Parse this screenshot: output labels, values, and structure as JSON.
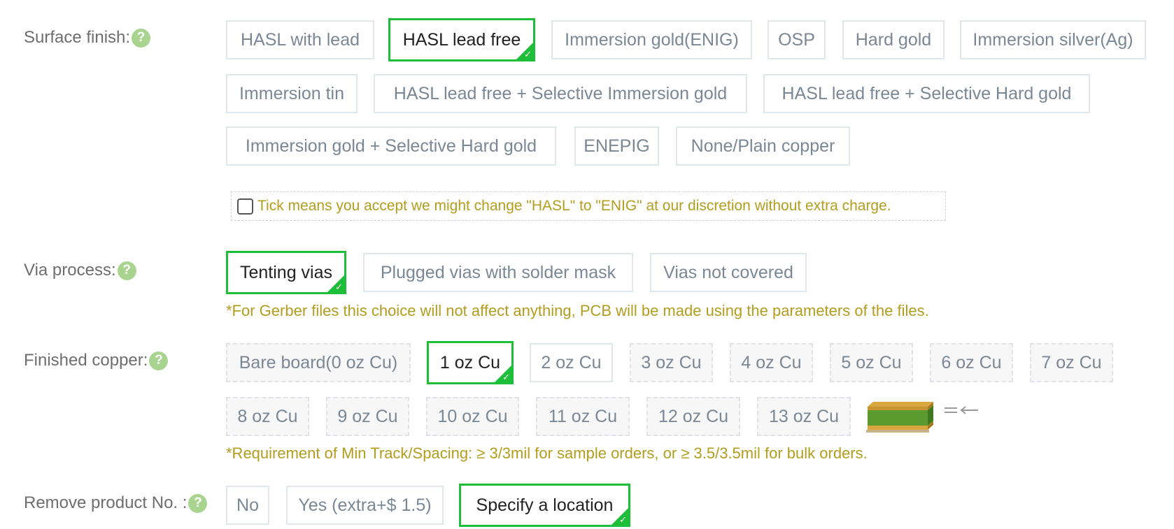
{
  "surface_finish": {
    "label": "Surface finish:",
    "options": [
      "HASL with lead",
      "HASL lead free",
      "Immersion gold(ENIG)",
      "OSP",
      "Hard gold",
      "Immersion silver(Ag)",
      "Immersion tin",
      "HASL lead free + Selective Immersion gold",
      "HASL lead free + Selective Hard gold",
      "Immersion gold + Selective Hard gold",
      "ENEPIG",
      "None/Plain copper"
    ],
    "selected": "HASL lead free",
    "accept_change_text": "Tick means you accept we might change \"HASL\" to \"ENIG\" at our discretion without extra charge.",
    "accept_change_checked": false
  },
  "via_process": {
    "label": "Via process:",
    "options": [
      "Tenting vias",
      "Plugged vias with solder mask",
      "Vias not covered"
    ],
    "selected": "Tenting vias",
    "note": "*For Gerber files this choice will not affect anything, PCB will be made using the parameters of the files."
  },
  "finished_copper": {
    "label": "Finished copper:",
    "options": [
      "Bare board(0 oz Cu)",
      "1 oz Cu",
      "2 oz Cu",
      "3 oz Cu",
      "4 oz Cu",
      "5 oz Cu",
      "6 oz Cu",
      "7 oz Cu",
      "8 oz Cu",
      "9 oz Cu",
      "10 oz Cu",
      "11 oz Cu",
      "12 oz Cu",
      "13 oz Cu"
    ],
    "selected": "1 oz Cu",
    "note": "*Requirement of Min Track/Spacing: ≥ 3/3mil for sample orders, or ≥ 3.5/3.5mil for bulk orders."
  },
  "remove_product_no": {
    "label": "Remove product No. :",
    "options": [
      "No",
      "Yes (extra+$ 1.5)",
      "Specify a location"
    ],
    "selected": "Specify a location"
  },
  "help_icon_text": "?",
  "check_glyph": "✓",
  "colors": {
    "selected_border": "#1fbe3a",
    "note_text": "#b39d1e",
    "help_icon": "#a8d490"
  }
}
